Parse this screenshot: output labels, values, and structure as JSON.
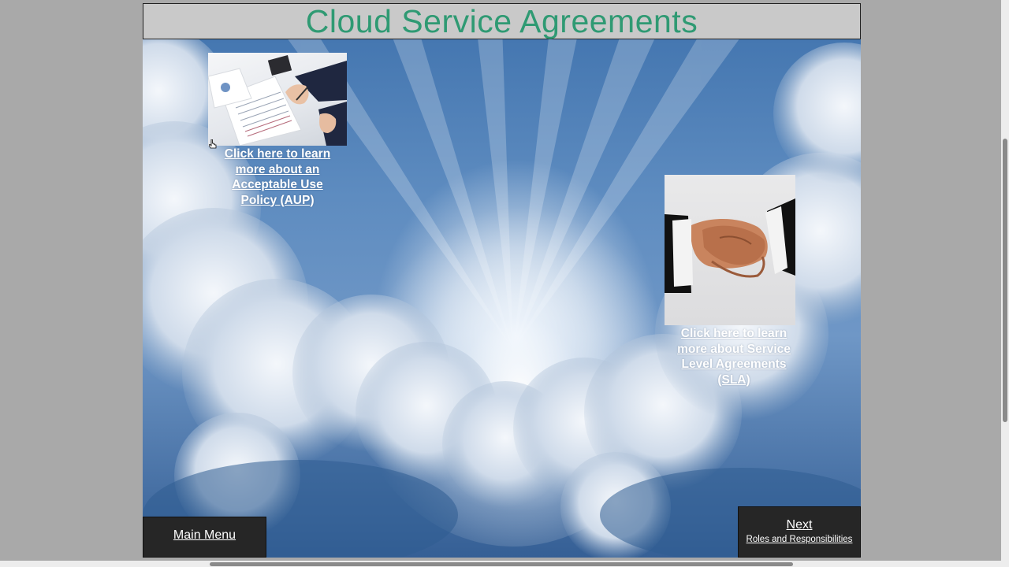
{
  "page": {
    "title": "Cloud Service Agreements"
  },
  "links": {
    "aup_label": "Click here to learn more about an Acceptable Use Policy (AUP)",
    "sla_label": "Click here to learn more about Service Level Agreements (SLA)"
  },
  "images": {
    "aup_photo": "paperwork-signing-photo",
    "sla_photo": "handshake-photo"
  },
  "navigation": {
    "main_menu_label": "Main Menu",
    "next_label": "Next",
    "next_subtitle": "Roles and Responsibilities"
  },
  "colors": {
    "title_color": "#2f9a73",
    "title_bar_bg": "#c9c9c9",
    "nav_bg": "#262626",
    "sky_blue": "#3f72ad"
  }
}
